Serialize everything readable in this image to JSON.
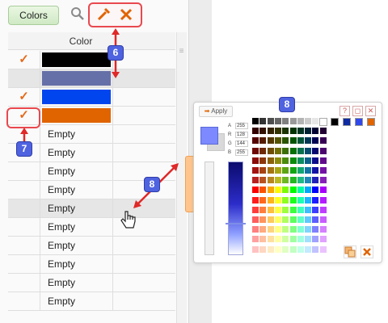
{
  "toolbar": {
    "colors_label": "Colors",
    "search_icon": "magnifier-icon",
    "pick_icon": "pipette-icon",
    "clear_icon": "x-cross-icon"
  },
  "grid": {
    "header": "Color",
    "rows": [
      {
        "checked": true,
        "color": "#000000",
        "label": ""
      },
      {
        "checked": false,
        "color": "#6670a8",
        "label": ""
      },
      {
        "checked": true,
        "color": "#0045ee",
        "label": ""
      },
      {
        "checked": true,
        "color": "#e06400",
        "label": ""
      },
      {
        "checked": false,
        "color": "",
        "label": "Empty"
      },
      {
        "checked": false,
        "color": "",
        "label": "Empty"
      },
      {
        "checked": false,
        "color": "",
        "label": "Empty"
      },
      {
        "checked": false,
        "color": "",
        "label": "Empty"
      },
      {
        "checked": false,
        "color": "",
        "label": "Empty"
      },
      {
        "checked": false,
        "color": "",
        "label": "Empty"
      },
      {
        "checked": false,
        "color": "",
        "label": "Empty"
      },
      {
        "checked": false,
        "color": "",
        "label": "Empty"
      },
      {
        "checked": false,
        "color": "",
        "label": "Empty"
      },
      {
        "checked": false,
        "color": "",
        "label": "Empty"
      }
    ],
    "check_glyph": "✓"
  },
  "callouts": {
    "six": "6",
    "seven": "7",
    "eight_a": "8",
    "eight_b": "8"
  },
  "popup": {
    "apply_label": "Apply",
    "help_btn": "?",
    "restore_btn": "◻",
    "close_btn": "✕",
    "rgba": {
      "A": "255",
      "R": "128",
      "G": "144",
      "B": "255"
    },
    "accent_colors": [
      "#000000",
      "#0f2aa0",
      "#3048e8",
      "#e06400"
    ],
    "preview_color": "#7d8aff"
  }
}
